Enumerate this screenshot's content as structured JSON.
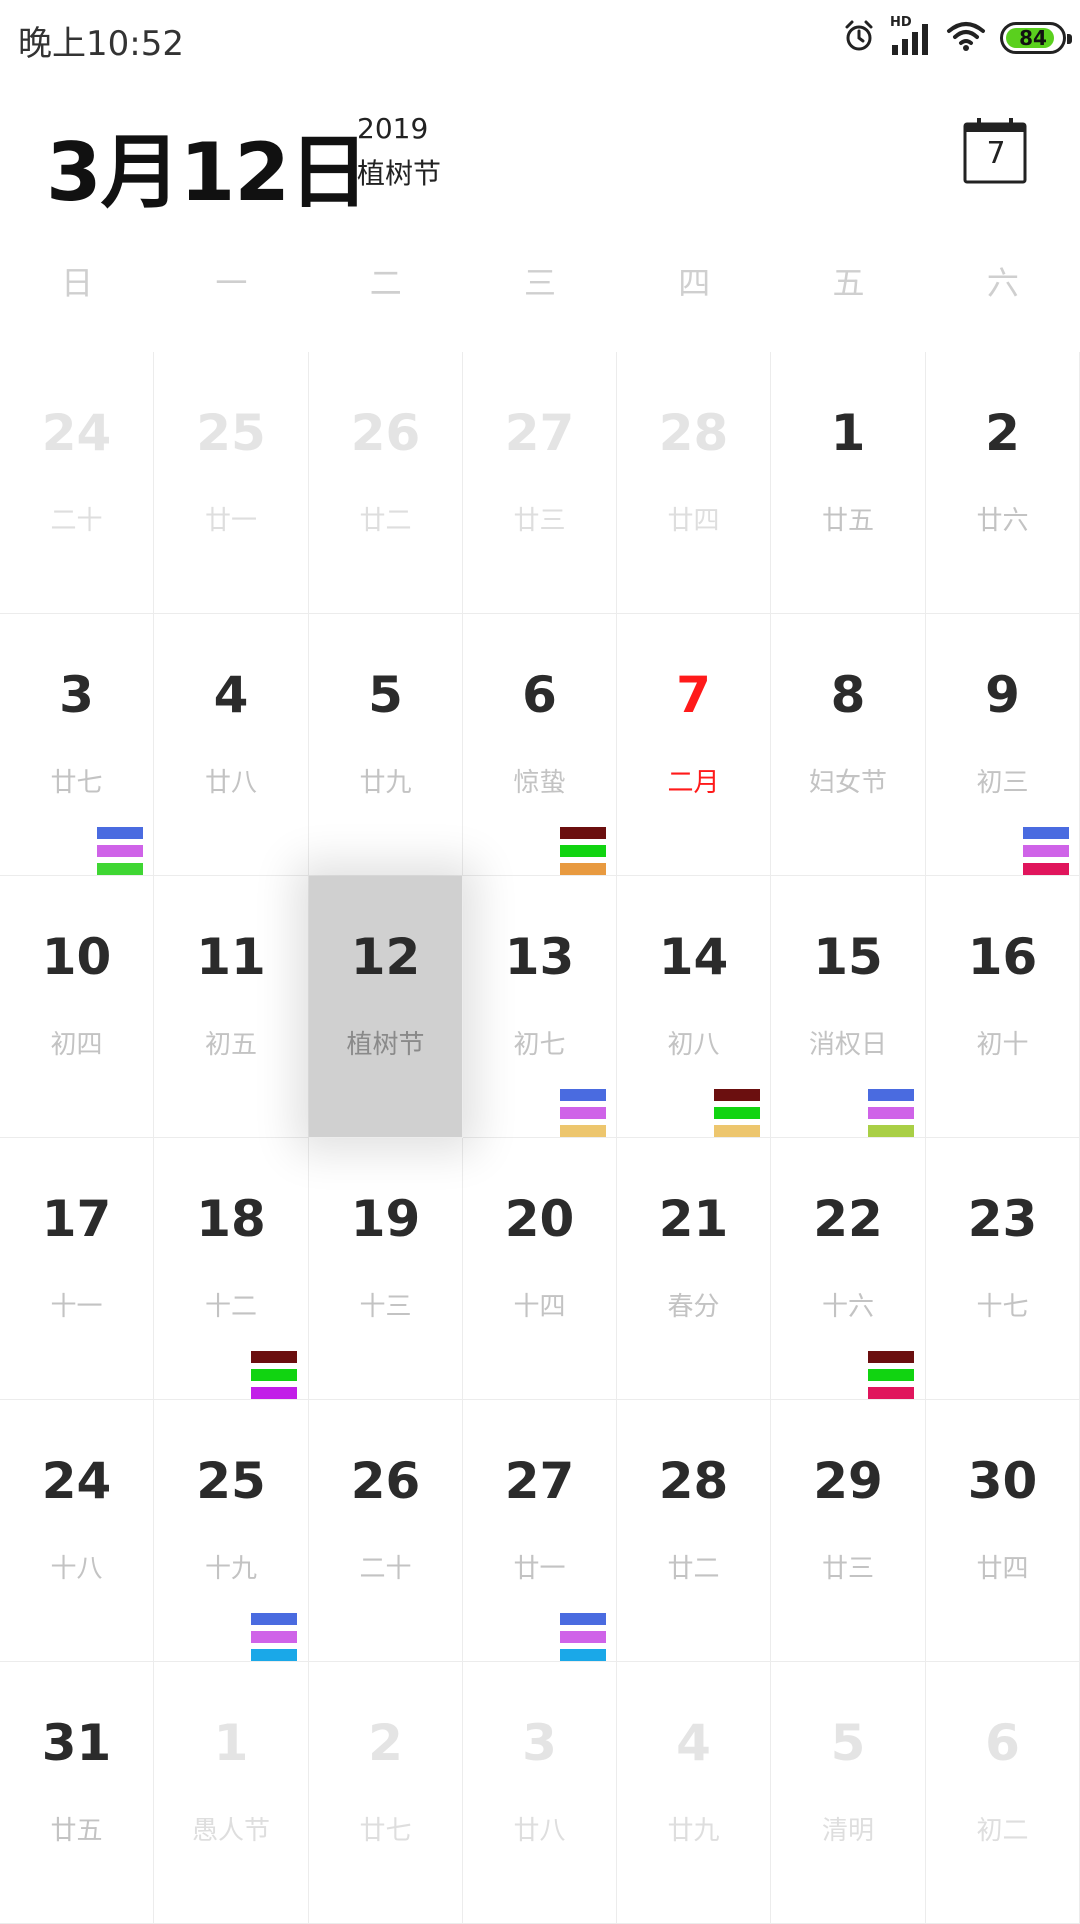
{
  "status_bar": {
    "time": "晚上10:52",
    "network_label": "HD",
    "battery_level": "84",
    "battery_color": "#5ad01e"
  },
  "header": {
    "date": "3月12日",
    "year": "2019",
    "festival": "植树节",
    "today_button_day": "7"
  },
  "weekdays": [
    "日",
    "一",
    "二",
    "三",
    "四",
    "五",
    "六"
  ],
  "calendar": {
    "cells": [
      {
        "day": "24",
        "lunar": "二十",
        "state": "other",
        "bars": []
      },
      {
        "day": "25",
        "lunar": "廿一",
        "state": "other",
        "bars": []
      },
      {
        "day": "26",
        "lunar": "廿二",
        "state": "other",
        "bars": []
      },
      {
        "day": "27",
        "lunar": "廿三",
        "state": "other",
        "bars": []
      },
      {
        "day": "28",
        "lunar": "廿四",
        "state": "other",
        "bars": []
      },
      {
        "day": "1",
        "lunar": "廿五",
        "state": "normal",
        "bars": []
      },
      {
        "day": "2",
        "lunar": "廿六",
        "state": "normal",
        "bars": []
      },
      {
        "day": "3",
        "lunar": "廿七",
        "state": "normal",
        "bars": [
          "#4a6be0",
          "#cf63e8",
          "#3fd633"
        ]
      },
      {
        "day": "4",
        "lunar": "廿八",
        "state": "normal",
        "bars": []
      },
      {
        "day": "5",
        "lunar": "廿九",
        "state": "normal",
        "bars": []
      },
      {
        "day": "6",
        "lunar": "惊蛰",
        "state": "normal",
        "bars": [
          "#6b0f0f",
          "#11d411",
          "#e89a40"
        ]
      },
      {
        "day": "7",
        "lunar": "二月",
        "state": "red",
        "bars": []
      },
      {
        "day": "8",
        "lunar": "妇女节",
        "state": "normal",
        "bars": []
      },
      {
        "day": "9",
        "lunar": "初三",
        "state": "normal",
        "bars": [
          "#4a6be0",
          "#cf63e8",
          "#e0155c"
        ]
      },
      {
        "day": "10",
        "lunar": "初四",
        "state": "normal",
        "bars": []
      },
      {
        "day": "11",
        "lunar": "初五",
        "state": "normal",
        "bars": []
      },
      {
        "day": "12",
        "lunar": "植树节",
        "state": "selected",
        "bars": []
      },
      {
        "day": "13",
        "lunar": "初七",
        "state": "normal",
        "bars": [
          "#4a6be0",
          "#cf63e8",
          "#edc66e"
        ]
      },
      {
        "day": "14",
        "lunar": "初八",
        "state": "normal",
        "bars": [
          "#6b0f0f",
          "#11d411",
          "#edc66e"
        ]
      },
      {
        "day": "15",
        "lunar": "消权日",
        "state": "normal",
        "bars": [
          "#4a6be0",
          "#cf63e8",
          "#a9cf46"
        ]
      },
      {
        "day": "16",
        "lunar": "初十",
        "state": "normal",
        "bars": []
      },
      {
        "day": "17",
        "lunar": "十一",
        "state": "normal",
        "bars": []
      },
      {
        "day": "18",
        "lunar": "十二",
        "state": "normal",
        "bars": [
          "#6b0f0f",
          "#11d411",
          "#c21ee8"
        ]
      },
      {
        "day": "19",
        "lunar": "十三",
        "state": "normal",
        "bars": []
      },
      {
        "day": "20",
        "lunar": "十四",
        "state": "normal",
        "bars": []
      },
      {
        "day": "21",
        "lunar": "春分",
        "state": "normal",
        "bars": []
      },
      {
        "day": "22",
        "lunar": "十六",
        "state": "normal",
        "bars": [
          "#6b0f0f",
          "#11d411",
          "#e0155c"
        ]
      },
      {
        "day": "23",
        "lunar": "十七",
        "state": "normal",
        "bars": []
      },
      {
        "day": "24",
        "lunar": "十八",
        "state": "normal",
        "bars": []
      },
      {
        "day": "25",
        "lunar": "十九",
        "state": "normal",
        "bars": [
          "#4a6be0",
          "#cf63e8",
          "#1aa8e8"
        ]
      },
      {
        "day": "26",
        "lunar": "二十",
        "state": "normal",
        "bars": []
      },
      {
        "day": "27",
        "lunar": "廿一",
        "state": "normal",
        "bars": [
          "#4a6be0",
          "#cf63e8",
          "#1aa8e8"
        ]
      },
      {
        "day": "28",
        "lunar": "廿二",
        "state": "normal",
        "bars": []
      },
      {
        "day": "29",
        "lunar": "廿三",
        "state": "normal",
        "bars": []
      },
      {
        "day": "30",
        "lunar": "廿四",
        "state": "normal",
        "bars": []
      },
      {
        "day": "31",
        "lunar": "廿五",
        "state": "normal",
        "bars": []
      },
      {
        "day": "1",
        "lunar": "愚人节",
        "state": "other",
        "bars": []
      },
      {
        "day": "2",
        "lunar": "廿七",
        "state": "other",
        "bars": []
      },
      {
        "day": "3",
        "lunar": "廿八",
        "state": "other",
        "bars": []
      },
      {
        "day": "4",
        "lunar": "廿九",
        "state": "other",
        "bars": []
      },
      {
        "day": "5",
        "lunar": "清明",
        "state": "other",
        "bars": []
      },
      {
        "day": "6",
        "lunar": "初二",
        "state": "other",
        "bars": []
      }
    ]
  }
}
